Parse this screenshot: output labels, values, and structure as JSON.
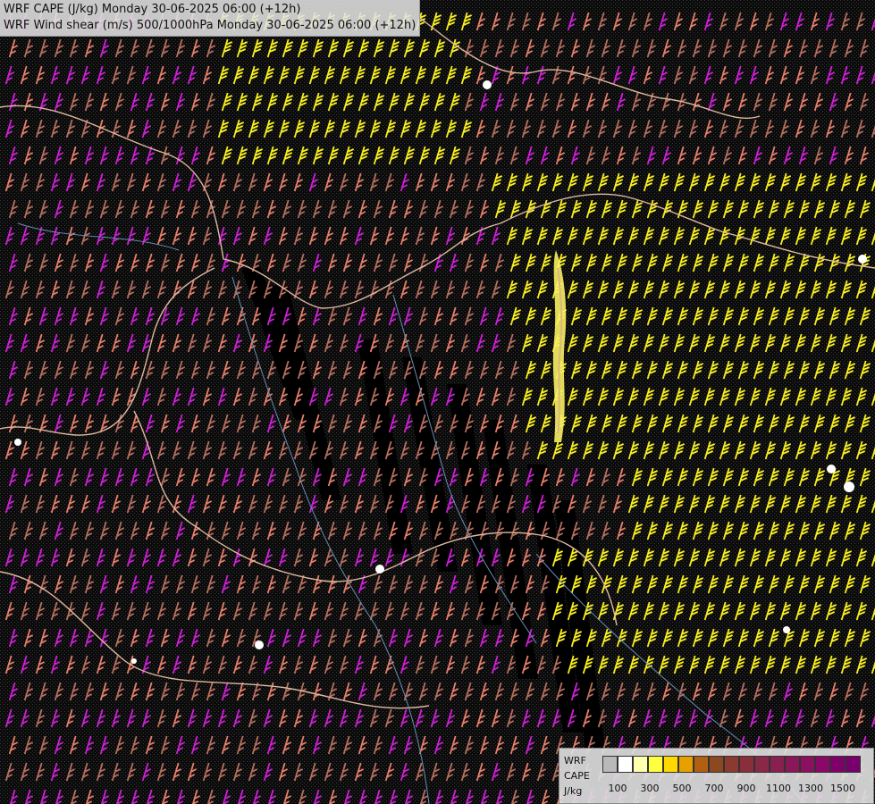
{
  "title": {
    "line1": "WRF CAPE (J/kg) Monday 30-06-2025 06:00 (+12h)",
    "line2": "WRF Wind shear (m/s) 500/1000hPa Monday 30-06-2025 06:00 (+12h)"
  },
  "legend": {
    "label_line1": "WRF",
    "label_line2": "CAPE",
    "label_line3": "J/kg",
    "colors": [
      "#b9b9b9",
      "#ffffff",
      "#ffffb0",
      "#ffff40",
      "#ffd800",
      "#e8a000",
      "#b06010",
      "#8c4820",
      "#8c3a30",
      "#8a2e3c",
      "#8a2848",
      "#8a2050",
      "#8a1858",
      "#8a1060",
      "#8a0868",
      "#80006a",
      "#78006c"
    ],
    "tick_labels": [
      "100",
      "300",
      "500",
      "700",
      "900",
      "1100",
      "1300",
      "1500"
    ]
  },
  "colors": {
    "barb_magenta": "#d020d8",
    "barb_salmon": "#e8806c",
    "barb_brown": "#b87060",
    "barb_yellow": "#f8f020",
    "border_line": "#e0b8a0",
    "river_line": "#6890b8",
    "contour_line": "#8a7a80"
  }
}
